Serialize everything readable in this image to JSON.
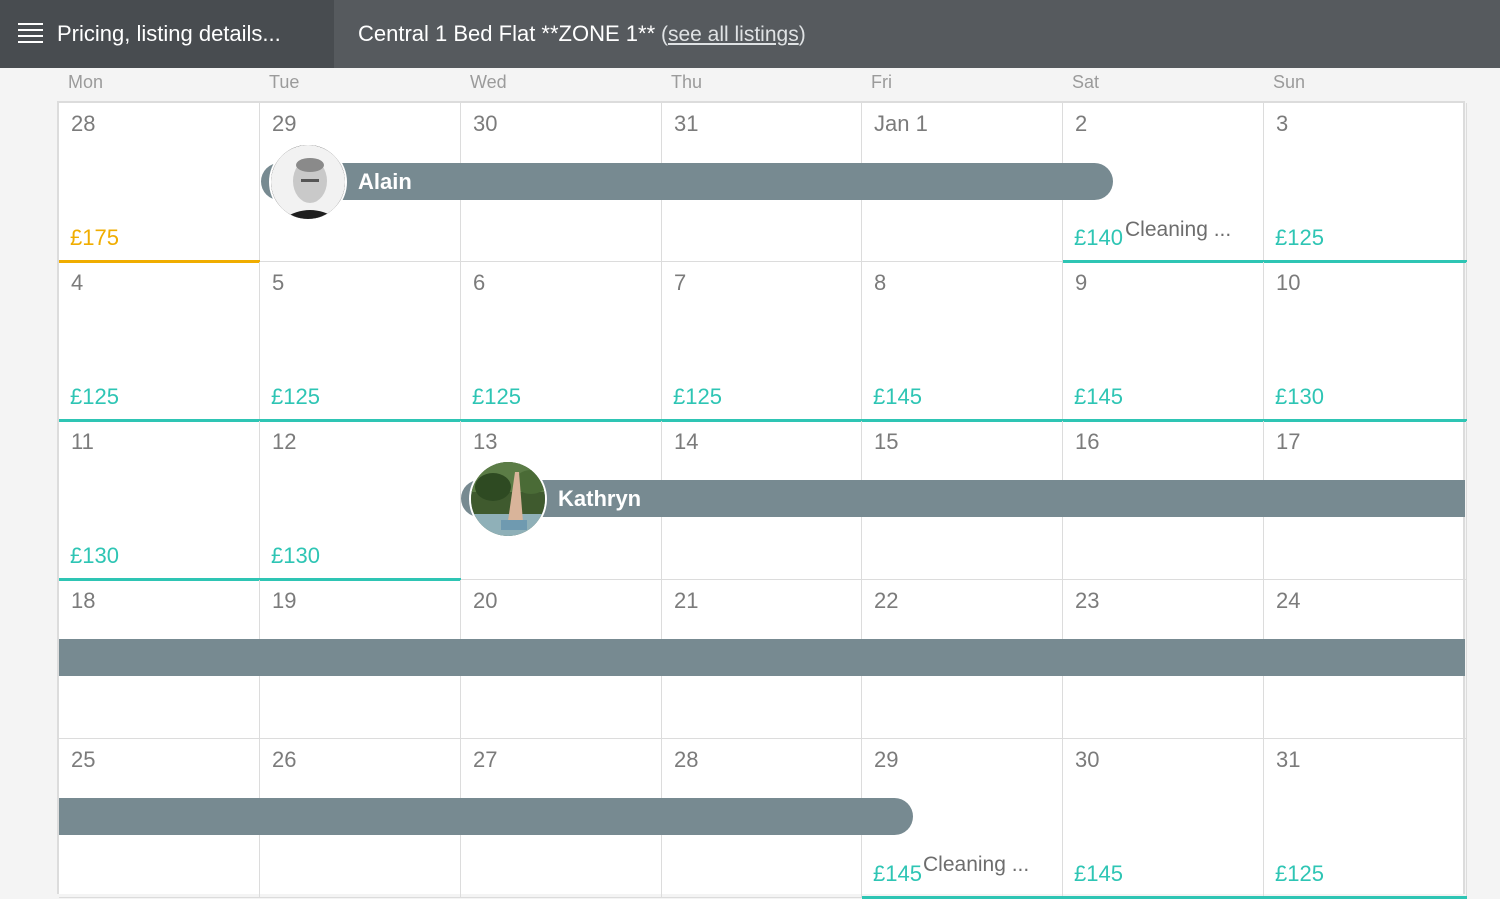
{
  "header": {
    "menu_label": "Pricing, listing details...",
    "listing_title": "Central 1 Bed Flat **ZONE 1**",
    "see_all_open": " (",
    "see_all_link": "see all listings",
    "see_all_close": ")"
  },
  "weekdays": [
    "Mon",
    "Tue",
    "Wed",
    "Thu",
    "Fri",
    "Sat",
    "Sun"
  ],
  "weeks": [
    [
      "28",
      "29",
      "30",
      "31",
      "Jan 1",
      "2",
      "3"
    ],
    [
      "4",
      "5",
      "6",
      "7",
      "8",
      "9",
      "10"
    ],
    [
      "11",
      "12",
      "13",
      "14",
      "15",
      "16",
      "17"
    ],
    [
      "18",
      "19",
      "20",
      "21",
      "22",
      "23",
      "24"
    ],
    [
      "25",
      "26",
      "27",
      "28",
      "29",
      "30",
      "31"
    ]
  ],
  "prices": [
    [
      "£175",
      "",
      "",
      "",
      "",
      "£140",
      "£125"
    ],
    [
      "£125",
      "£125",
      "£125",
      "£125",
      "£145",
      "£145",
      "£130"
    ],
    [
      "£130",
      "£130",
      "",
      "",
      "",
      "",
      ""
    ],
    [
      "",
      "",
      "",
      "",
      "",
      "",
      ""
    ],
    [
      "",
      "",
      "",
      "",
      "£145",
      "£145",
      "£125"
    ]
  ],
  "reservations": {
    "alain": "Alain",
    "kathryn": "Kathryn"
  },
  "cleaning": {
    "jan2": "Cleaning ...",
    "jan29": "Cleaning ..."
  },
  "colors": {
    "topbar": "#565a5e",
    "menu": "#484c50",
    "price_available": "#2ec5b4",
    "price_highlight": "#f0ad00",
    "reservation_bar": "#778a91"
  },
  "icons": {
    "menu": "hamburger-menu-icon"
  }
}
